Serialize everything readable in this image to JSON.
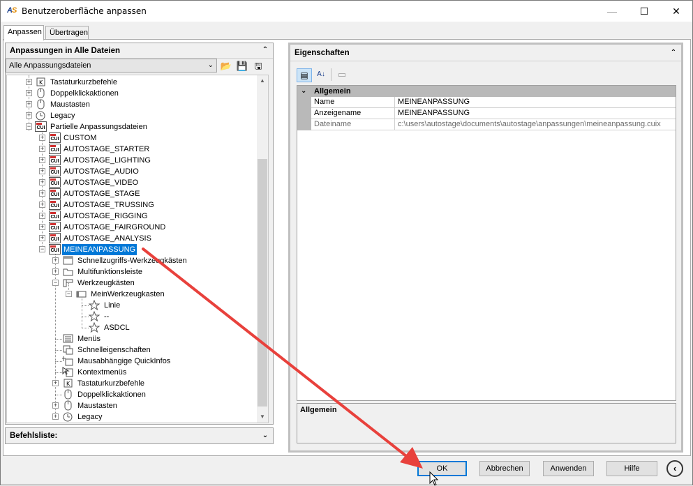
{
  "window": {
    "title": "Benutzeroberfläche anpassen",
    "app_icon_a": "A",
    "app_icon_s": "S",
    "minimize": "—",
    "maximize": "☐",
    "close": "✕"
  },
  "tabs": [
    {
      "label": "Anpassen"
    },
    {
      "label": "Übertragen"
    }
  ],
  "left_pane": {
    "title": "Anpassungen in Alle Dateien",
    "collapse": "⌃",
    "combo": {
      "value": "Alle Anpassungsdateien",
      "arrow": "⌄"
    },
    "tools": [
      {
        "icon": "open-folder-icon",
        "glyph": "📂"
      },
      {
        "icon": "save-icon",
        "glyph": "💾"
      },
      {
        "icon": "save-as-icon",
        "glyph": "🖫"
      }
    ],
    "tree": [
      {
        "label": "Tastaturkurzbefehle"
      },
      {
        "label": "Doppelklickaktionen"
      },
      {
        "label": "Maustasten"
      },
      {
        "label": "Legacy"
      },
      {
        "label": "Partielle Anpassungsdateien"
      },
      {
        "label": "CUSTOM"
      },
      {
        "label": "AUTOSTAGE_STARTER"
      },
      {
        "label": "AUTOSTAGE_LIGHTING"
      },
      {
        "label": "AUTOSTAGE_AUDIO"
      },
      {
        "label": "AUTOSTAGE_VIDEO"
      },
      {
        "label": "AUTOSTAGE_STAGE"
      },
      {
        "label": "AUTOSTAGE_TRUSSING"
      },
      {
        "label": "AUTOSTAGE_RIGGING"
      },
      {
        "label": "AUTOSTAGE_FAIRGROUND"
      },
      {
        "label": "AUTOSTAGE_ANALYSIS"
      },
      {
        "label": "MEINEANPASSUNG"
      },
      {
        "label": "Schnellzugriffs-Werkzeugkästen"
      },
      {
        "label": "Multifunktionsleiste"
      },
      {
        "label": "Werkzeugkästen"
      },
      {
        "label": "MeinWerkzeugkasten"
      },
      {
        "label": "Linie"
      },
      {
        "label": "--"
      },
      {
        "label": "ASDCL"
      },
      {
        "label": "Menüs"
      },
      {
        "label": "Schnelleigenschaften"
      },
      {
        "label": "Mausabhängige QuickInfos"
      },
      {
        "label": "Kontextmenüs"
      },
      {
        "label": "Tastaturkurzbefehle"
      },
      {
        "label": "Doppelklickaktionen"
      },
      {
        "label": "Maustasten"
      },
      {
        "label": "Legacy"
      }
    ],
    "cui_text": "CUI",
    "plus": "+",
    "minus": "−",
    "scroll_up": "▲",
    "scroll_down": "▼"
  },
  "command_list": {
    "title": "Befehlsliste:",
    "expand": "⌄"
  },
  "right_pane": {
    "title": "Eigenschaften",
    "collapse": "⌃",
    "toolbar": {
      "categorized": "▤",
      "alpha": "A↓",
      "pages": "▭"
    },
    "category": {
      "label": "Allgemein",
      "toggle": "⌄"
    },
    "properties": [
      {
        "name": "Name",
        "value": "MEINEANPASSUNG"
      },
      {
        "name": "Anzeigename",
        "value": "MEINEANPASSUNG"
      },
      {
        "name": "Dateiname",
        "value": "c:\\users\\autostage\\documents\\autostage\\anpassungen\\meineanpassung.cuix"
      }
    ],
    "help_title": "Allgemein"
  },
  "buttons": {
    "ok": "OK",
    "cancel": "Abbrechen",
    "apply": "Anwenden",
    "help": "Hilfe",
    "more": "‹"
  },
  "annotation": {
    "arrow_color": "#e8413c"
  }
}
